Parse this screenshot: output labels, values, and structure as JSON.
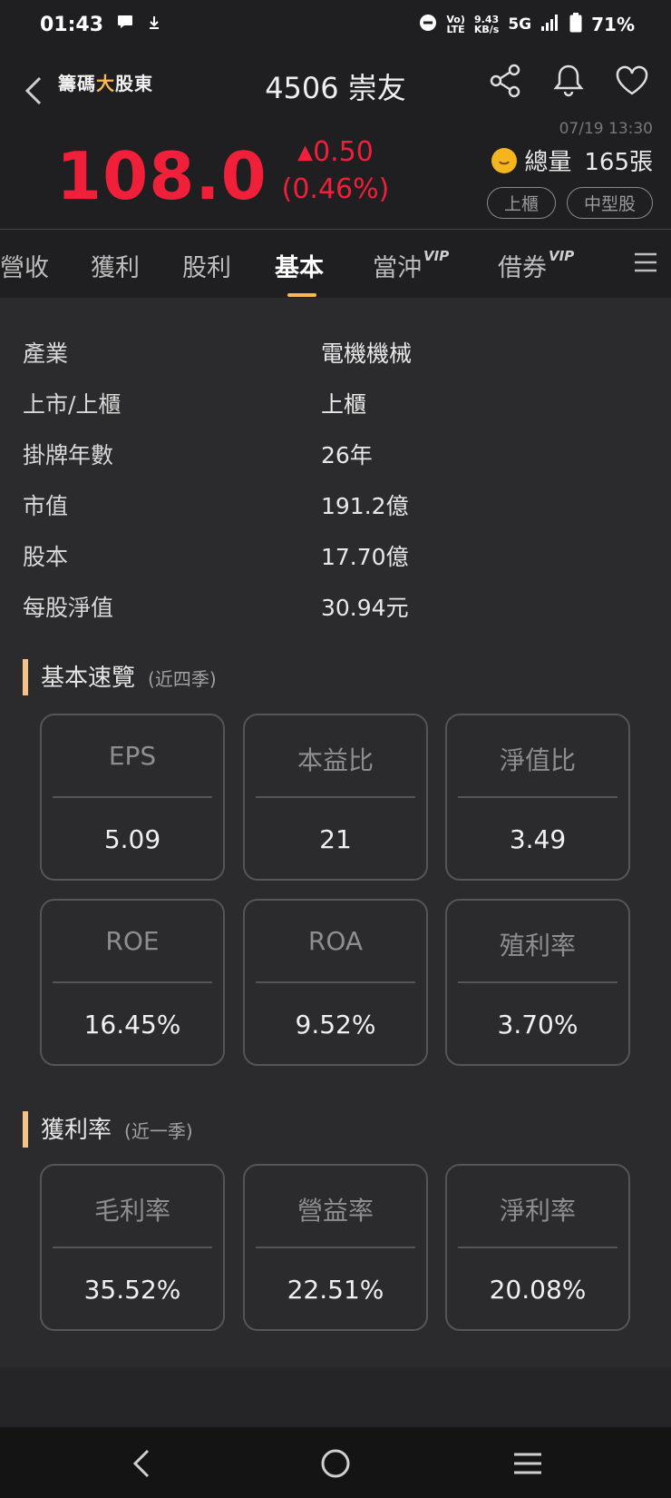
{
  "status": {
    "time": "01:43",
    "net_top": "9.43",
    "net_bottom": "KB/s",
    "network": "5G",
    "lte_top": "Vo)",
    "lte_bottom": "LTE",
    "battery": "71%"
  },
  "header": {
    "brand_part1": "籌碼",
    "brand_accent": "大",
    "brand_part2": "股東",
    "title": "4506 崇友",
    "timestamp": "07/19 13:30",
    "price": "108.0",
    "change": "0.50",
    "change_pct": "(0.46%)",
    "volume_label": "總量",
    "volume_value": "165張",
    "tags": [
      "上櫃",
      "中型股"
    ],
    "accent_color": "#f0203a"
  },
  "tabs": [
    {
      "label": "營收"
    },
    {
      "label": "獲利"
    },
    {
      "label": "股利"
    },
    {
      "label": "基本"
    },
    {
      "label": "當沖",
      "vip": "VIP"
    },
    {
      "label": "借券",
      "vip": "VIP"
    }
  ],
  "info": [
    {
      "label": "產業",
      "value": "電機機械"
    },
    {
      "label": "上市/上櫃",
      "value": "上櫃"
    },
    {
      "label": "掛牌年數",
      "value": "26年"
    },
    {
      "label": "市值",
      "value": "191.2億"
    },
    {
      "label": "股本",
      "value": "17.70億"
    },
    {
      "label": "每股淨值",
      "value": "30.94元"
    }
  ],
  "overview": {
    "title": "基本速覽",
    "subtitle": "(近四季)",
    "cards": [
      {
        "label": "EPS",
        "value": "5.09"
      },
      {
        "label": "本益比",
        "value": "21"
      },
      {
        "label": "淨值比",
        "value": "3.49"
      },
      {
        "label": "ROE",
        "value": "16.45%"
      },
      {
        "label": "ROA",
        "value": "9.52%"
      },
      {
        "label": "殖利率",
        "value": "3.70%"
      }
    ]
  },
  "profitability": {
    "title": "獲利率",
    "subtitle": "(近一季)",
    "cards": [
      {
        "label": "毛利率",
        "value": "35.52%"
      },
      {
        "label": "營益率",
        "value": "22.51%"
      },
      {
        "label": "淨利率",
        "value": "20.08%"
      }
    ]
  }
}
